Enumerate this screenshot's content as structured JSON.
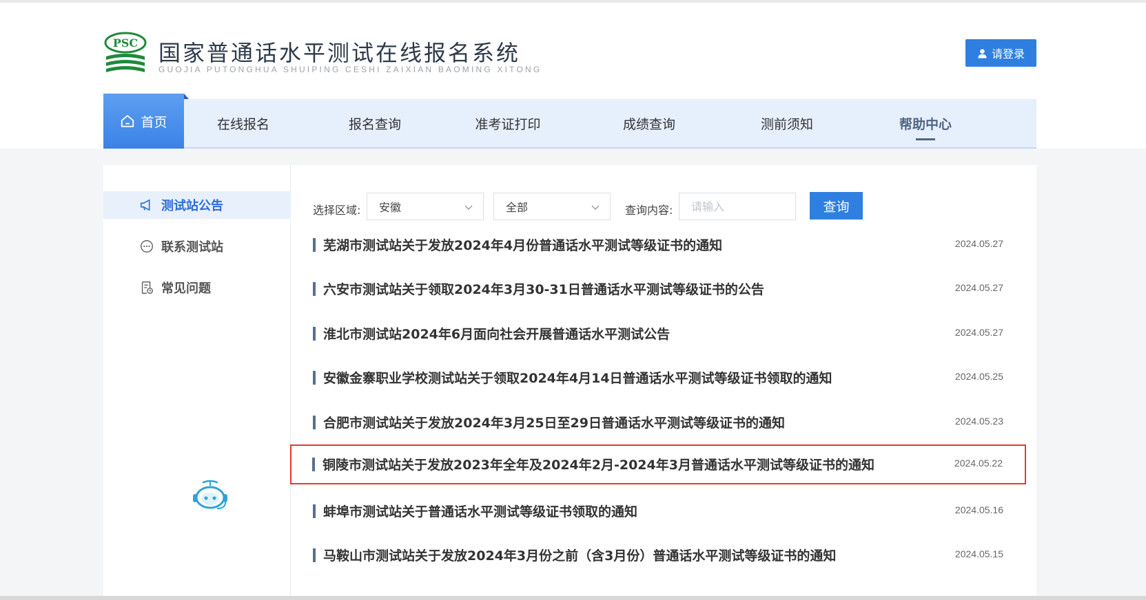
{
  "header": {
    "logo_mark_text": "PSC",
    "title": "国家普通话水平测试在线报名系统",
    "subtitle": "GUOJIA PUTONGHUA SHUIPING CESHI ZAIXIAN BAOMING XITONG",
    "login_label": "请登录"
  },
  "nav": {
    "home": "首页",
    "items": [
      "在线报名",
      "报名查询",
      "准考证打印",
      "成绩查询",
      "测前须知"
    ],
    "help": "帮助中心"
  },
  "sidebar": {
    "items": [
      {
        "label": "测试站公告",
        "icon": "megaphone-icon"
      },
      {
        "label": "联系测试站",
        "icon": "chat-icon"
      },
      {
        "label": "常见问题",
        "icon": "document-icon"
      }
    ]
  },
  "filter": {
    "region_label": "选择区域:",
    "region_value": "安徽",
    "type_value": "全部",
    "query_label": "查询内容:",
    "query_placeholder": "请输入",
    "search_label": "查询"
  },
  "news": [
    {
      "title": "芜湖市测试站关于发放2024年4月份普通话水平测试等级证书的通知",
      "date": "2024.05.27"
    },
    {
      "title": "六安市测试站关于领取2024年3月30-31日普通话水平测试等级证书的公告",
      "date": "2024.05.27"
    },
    {
      "title": "淮北市测试站2024年6月面向社会开展普通话水平测试公告",
      "date": "2024.05.27"
    },
    {
      "title": "安徽金寨职业学校测试站关于领取2024年4月14日普通话水平测试等级证书领取的通知",
      "date": "2024.05.25"
    },
    {
      "title": "合肥市测试站关于发放2024年3月25日至29日普通话水平测试等级证书的通知",
      "date": "2024.05.23"
    },
    {
      "title": "铜陵市测试站关于发放2023年全年及2024年2月-2024年3月普通话水平测试等级证书的通知",
      "date": "2024.05.22"
    },
    {
      "title": "蚌埠市测试站关于普通话水平测试等级证书领取的通知",
      "date": "2024.05.16"
    },
    {
      "title": "马鞍山市测试站关于发放2024年3月份之前（含3月份）普通话水平测试等级证书的通知",
      "date": "2024.05.15"
    }
  ],
  "colors": {
    "accent": "#2f7fe0",
    "highlight_border": "#e23b2e",
    "logo_green": "#1f8a3a"
  }
}
